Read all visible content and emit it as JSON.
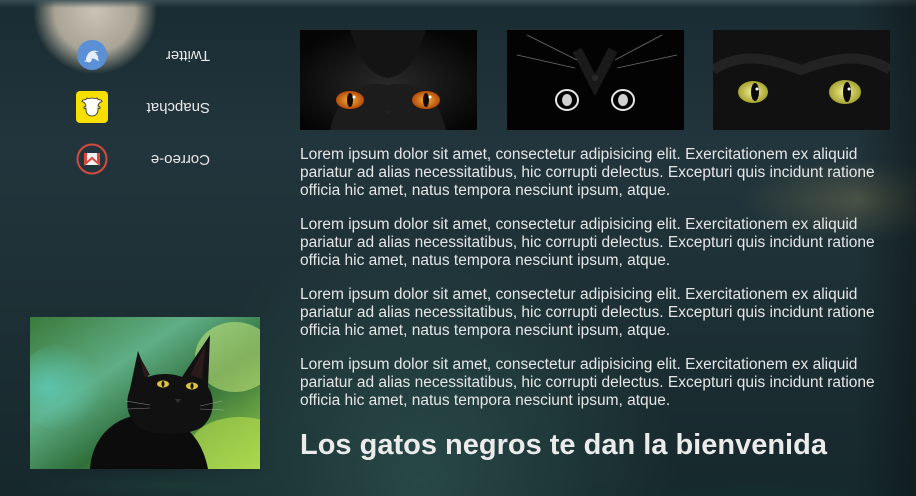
{
  "social": {
    "items": [
      {
        "label": "Twitter",
        "icon": "twitter-icon",
        "color": "#5b8fd6"
      },
      {
        "label": "Snapchat",
        "icon": "snapchat-icon",
        "color": "#f7e000"
      },
      {
        "label": "Correo-e",
        "icon": "mail-icon",
        "color": "#d64a3c"
      }
    ]
  },
  "main": {
    "paragraphs": [
      "Lorem ipsum dolor sit amet, consectetur adipisicing elit. Exercitationem ex aliquid pariatur ad alias necessitatibus, hic corrupti delectus. Excepturi quis incidunt ratione officia hic amet, natus tempora nesciunt ipsum, atque.",
      "Lorem ipsum dolor sit amet, consectetur adipisicing elit. Exercitationem ex aliquid pariatur ad alias necessitatibus, hic corrupti delectus. Excepturi quis incidunt ratione officia hic amet, natus tempora nesciunt ipsum, atque.",
      "Lorem ipsum dolor sit amet, consectetur adipisicing elit. Exercitationem ex aliquid pariatur ad alias necessitatibus, hic corrupti delectus. Excepturi quis incidunt ratione officia hic amet, natus tempora nesciunt ipsum, atque.",
      "Lorem ipsum dolor sit amet, consectetur adipisicing elit. Exercitationem ex aliquid pariatur ad alias necessitatibus, hic corrupti delectus. Excepturi quis incidunt ratione officia hic amet, natus tempora nesciunt ipsum, atque."
    ],
    "headline": "Los gatos negros te dan la bienvenida"
  },
  "colors": {
    "text": "#e6e6e6",
    "cat_eye_orange": "#e0731a",
    "cat_eye_yellow": "#d8dc6a"
  }
}
